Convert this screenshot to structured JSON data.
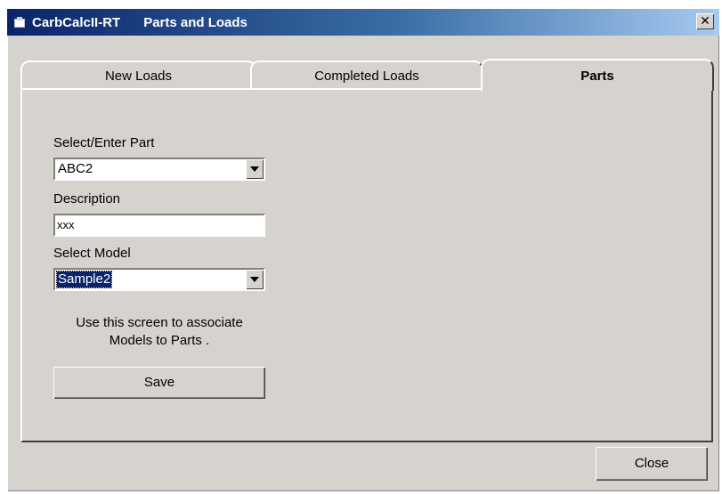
{
  "window": {
    "app_name": "CarbCalcII-RT",
    "title": "Parts and Loads",
    "close_glyph": "✕"
  },
  "tabs": [
    {
      "label": "New Loads",
      "active": false
    },
    {
      "label": "Completed Loads",
      "active": false
    },
    {
      "label": "Parts",
      "active": true
    }
  ],
  "form": {
    "part_label": "Select/Enter Part",
    "part_value": "ABC2",
    "description_label": "Description",
    "description_value": "xxx",
    "model_label": "Select Model",
    "model_value": "Sample2",
    "hint_line1": "Use this screen to associate",
    "hint_line2": "Models to Parts .",
    "save_label": "Save"
  },
  "footer": {
    "close_label": "Close"
  },
  "colors": {
    "face": "#d6d3ce",
    "titlebar_start": "#0a246a",
    "titlebar_end": "#a6caf0",
    "selection": "#0a246a"
  },
  "icons": {
    "app": "app-icon",
    "close": "close-icon",
    "dropdown": "chevron-down-icon"
  }
}
